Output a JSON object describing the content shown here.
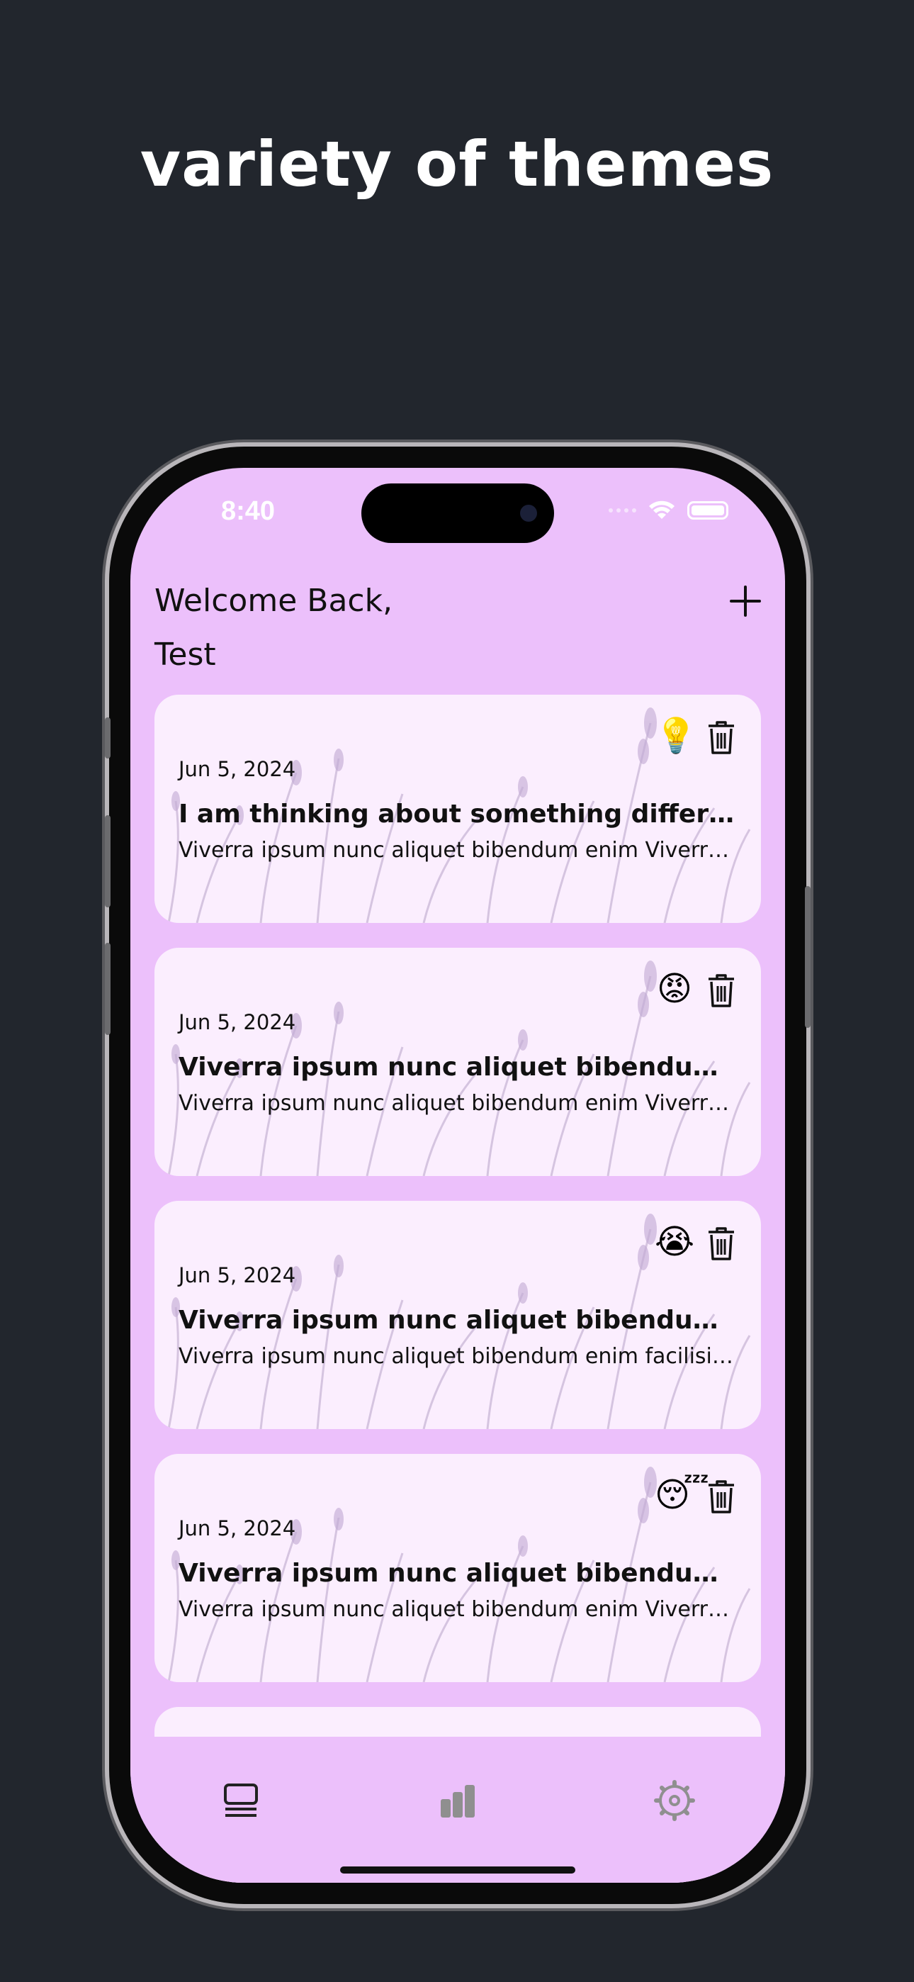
{
  "headline": "variety of themes",
  "status_bar": {
    "time": "8:40"
  },
  "header": {
    "greeting": "Welcome Back,",
    "user_name": "Test",
    "add_icon": "plus-icon"
  },
  "entries": [
    {
      "date": "Jun 5, 2024",
      "title": "I am thinking about something different",
      "body": "Viverra ipsum nunc aliquet bibendum enim Viverra ipsum nunc aliquet bibendum enim",
      "mood_emoji": "💡",
      "delete_icon": "trash-icon"
    },
    {
      "date": "Jun 5, 2024",
      "title": "Viverra ipsum nunc aliquet bibendum enim facilisis",
      "body": "Viverra ipsum nunc aliquet bibendum enim Viverra ipsum nunc aliquet bibendum enim",
      "mood_emoji": "😡",
      "delete_icon": "trash-icon"
    },
    {
      "date": "Jun 5, 2024",
      "title": "Viverra ipsum nunc aliquet bibendum enim facilisis",
      "body": "Viverra ipsum nunc aliquet bibendum enim facilisis Viverra ipsum nunc aliquet",
      "mood_emoji": "😭",
      "delete_icon": "trash-icon"
    },
    {
      "date": "Jun 5, 2024",
      "title": "Viverra ipsum nunc aliquet bibendum enim facilisis",
      "body": "Viverra ipsum nunc aliquet bibendum enim Viverra ipsum nunc aliquet bibendum enim",
      "mood_emoji": "😴",
      "delete_icon": "trash-icon"
    }
  ],
  "tab_bar": {
    "tabs": [
      {
        "icon": "journal-list-icon",
        "active": true
      },
      {
        "icon": "bar-chart-icon",
        "active": false
      },
      {
        "icon": "settings-gear-icon",
        "active": false
      }
    ]
  },
  "colors": {
    "background": "#22262d",
    "screen": "#ecc0fb",
    "card": "#fbeefe",
    "text": "#111111"
  }
}
